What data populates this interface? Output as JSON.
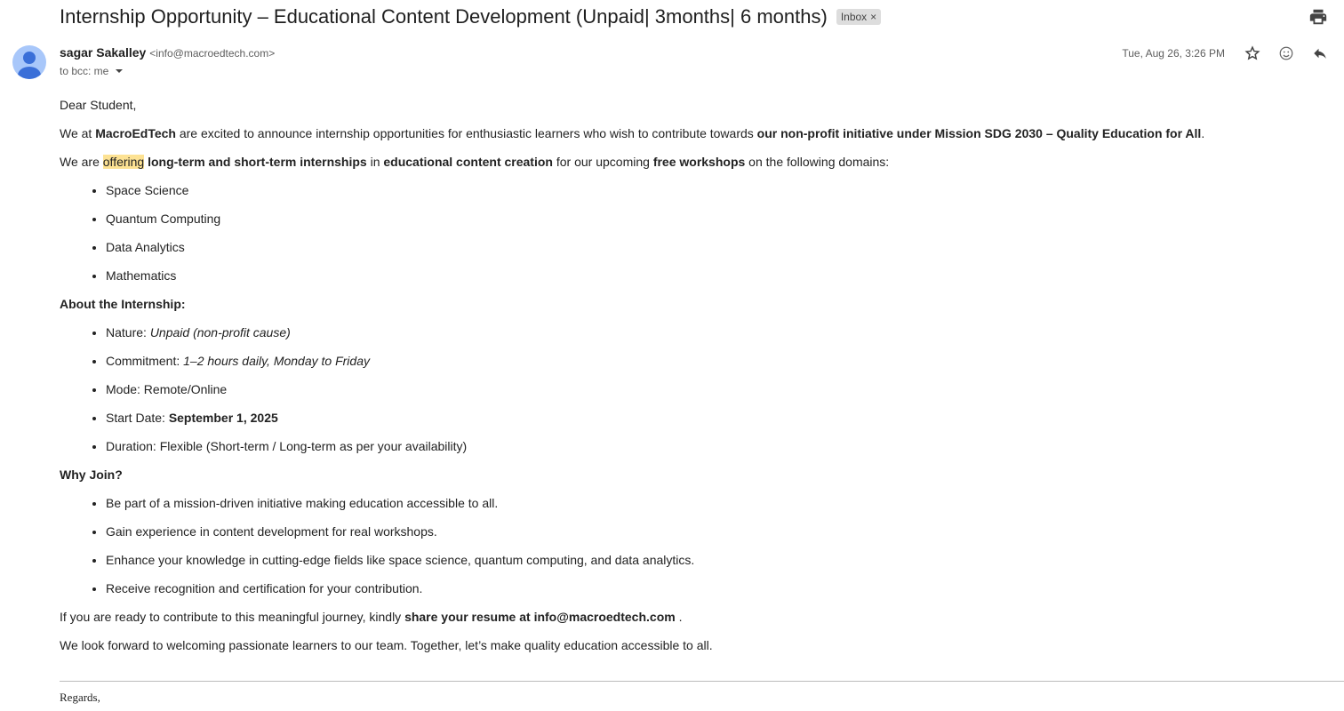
{
  "subject": "Internship Opportunity – Educational Content Development (Unpaid| 3months| 6 months)",
  "label_chip": {
    "text": "Inbox",
    "close": "×"
  },
  "sender": {
    "name": "sagar Sakalley",
    "email": "<info@macroedtech.com>"
  },
  "recipient": "to bcc: me",
  "date": "Tue, Aug 26, 3:26 PM",
  "icons": [
    "print-icon",
    "star-icon",
    "emoji-icon",
    "reply-icon",
    "avatar-icon",
    "chevron-down-icon"
  ],
  "colors": {
    "highlight": "#fde293",
    "avatar_bg": "#a8c7fa",
    "avatar_fg": "#3a6fd8"
  },
  "body": {
    "greeting": "Dear Student,",
    "p1": {
      "a": "We at ",
      "b": "MacroEdTech",
      "c": " are excited to announce internship opportunities for enthusiastic learners who wish to contribute towards ",
      "d": "our non-profit initiative under Mission SDG 2030 – Quality Education for All",
      "e": "."
    },
    "p2": {
      "a": "We are ",
      "hl": "offering",
      "b": " long-term and short-term internships",
      "c": " in ",
      "d": "educational content creation",
      "e": " for our upcoming ",
      "f": "free workshops",
      "g": " on the following domains:"
    },
    "domains": [
      "Space Science",
      "Quantum Computing",
      "Data Analytics",
      "Mathematics"
    ],
    "about_heading": "About the Internship:",
    "about": {
      "nature_label": "Nature: ",
      "nature_value": "Unpaid (non-profit cause)",
      "commitment_label": "Commitment: ",
      "commitment_value": "1–2 hours daily, Monday to Friday",
      "mode": "Mode: Remote/Online",
      "start_label": "Start Date: ",
      "start_value": "September 1, 2025",
      "duration": "Duration: Flexible (Short-term / Long-term as per your availability)"
    },
    "why_heading": "Why Join?",
    "why": [
      "Be part of a mission-driven initiative making education accessible to all.",
      "Gain experience in content development for real workshops.",
      "Enhance your knowledge in cutting-edge fields like space science, quantum computing, and data analytics.",
      "Receive recognition and certification for your contribution."
    ],
    "cta": {
      "a": "If you are ready to contribute to this meaningful journey, kindly ",
      "b": "share your resume at info@macroedtech.com",
      "c": " ."
    },
    "closing": "We look forward to welcoming passionate learners to our team. Together, let’s make quality education accessible to all.",
    "regards": "Regards,"
  }
}
